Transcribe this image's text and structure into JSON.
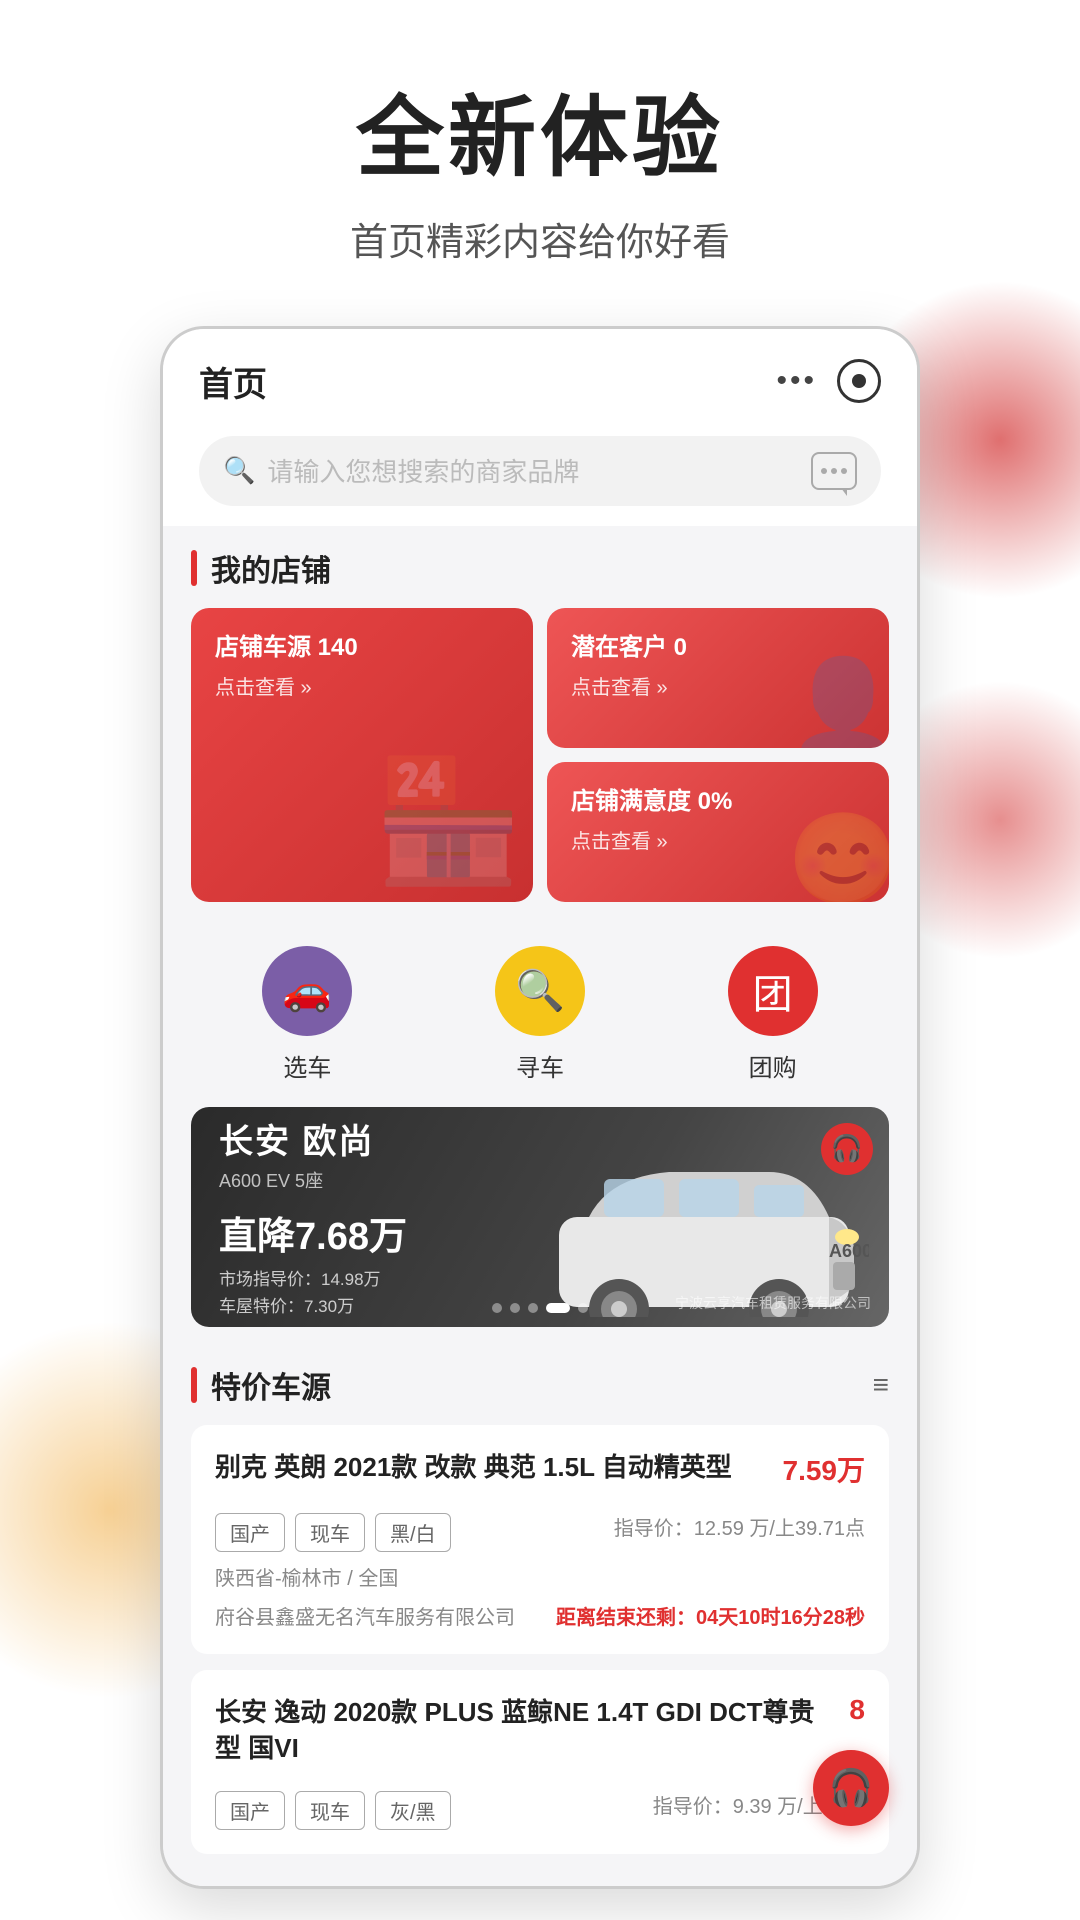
{
  "hero": {
    "title": "全新体验",
    "subtitle": "首页精彩内容给你好看"
  },
  "phone": {
    "header": {
      "title": "首页",
      "dots": "•••"
    },
    "search": {
      "placeholder": "请输入您想搜索的商家品牌"
    },
    "myStore": {
      "sectionTitle": "我的店铺",
      "cards": [
        {
          "title": "店铺车源 140",
          "action": "点击查看 »",
          "type": "large-red"
        },
        {
          "title": "潜在客户 0",
          "action": "点击查看 »",
          "type": "red"
        },
        {
          "title": "店铺满意度 0%",
          "action": "点击查看 »",
          "type": "red"
        }
      ]
    },
    "quickLinks": [
      {
        "label": "选车",
        "color": "purple",
        "icon": "🚗"
      },
      {
        "label": "寻车",
        "color": "yellow",
        "icon": "🔍"
      },
      {
        "label": "团购",
        "color": "red",
        "icon": "🏷"
      }
    ],
    "banner": {
      "brand": "长安 欧尚",
      "model": "A600 EV 5座",
      "discount": "直降7.68万",
      "marketPrice": "市场指导价：14.98万",
      "specialPrice": "车屋特价：7.30万",
      "company": "宁波云享汽车租赁服务有限公司",
      "dots": [
        "",
        "",
        "",
        "active",
        ""
      ]
    },
    "specialCars": {
      "sectionTitle": "特价车源",
      "listings": [
        {
          "title": "别克 英朗 2021款 改款 典范 1.5L 自动精英型",
          "price": "7.59万",
          "tags": [
            "国产",
            "现车",
            "黑/白"
          ],
          "guidePrice": "指导价：12.59 万/上39.71点",
          "location": "陕西省-榆林市 / 全国",
          "dealer": "府谷县鑫盛无名汽车服务有限公司",
          "countdown": "距离结束还剩：04天10时16分28秒"
        },
        {
          "title": "长安 逸动 2020款 PLUS 蓝鲸NE 1.4T GDI DCT尊贵型 国VI",
          "price": "8",
          "tags": [
            "国产",
            "现车",
            "灰/黑"
          ],
          "guidePrice": "指导价：9.39 万/上10点"
        }
      ]
    }
  }
}
